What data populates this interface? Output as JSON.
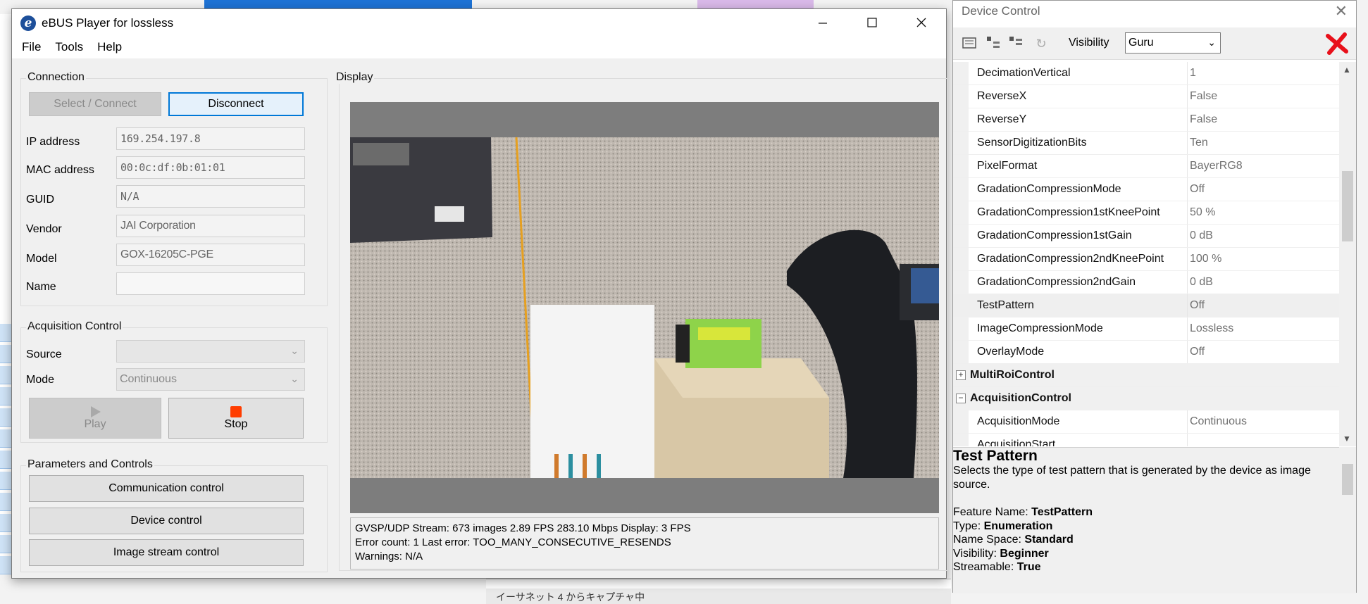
{
  "main_window": {
    "title": "eBUS Player for lossless",
    "menu": [
      "File",
      "Tools",
      "Help"
    ]
  },
  "connection": {
    "group_label": "Connection",
    "select_connect_label": "Select / Connect",
    "disconnect_label": "Disconnect",
    "fields": [
      {
        "label": "IP address",
        "value": "169.254.197.8"
      },
      {
        "label": "MAC address",
        "value": "00:0c:df:0b:01:01"
      },
      {
        "label": "GUID",
        "value": "N/A"
      },
      {
        "label": "Vendor",
        "value": "JAI Corporation"
      },
      {
        "label": "Model",
        "value": "GOX-16205C-PGE"
      },
      {
        "label": "Name",
        "value": ""
      }
    ]
  },
  "acquisition": {
    "group_label": "Acquisition Control",
    "source_label": "Source",
    "source_value": "",
    "mode_label": "Mode",
    "mode_value": "Continuous",
    "play_label": "Play",
    "stop_label": "Stop"
  },
  "params": {
    "group_label": "Parameters and Controls",
    "buttons": [
      "Communication control",
      "Device control",
      "Image stream control"
    ]
  },
  "display": {
    "group_label": "Display",
    "stats_line1": "GVSP/UDP Stream: 673 images    2.89 FPS    283.10 Mbps    Display: 3 FPS",
    "stats_line2": "Error count: 1    Last error: TOO_MANY_CONSECUTIVE_RESENDS",
    "stats_line3": "Warnings: N/A"
  },
  "device_control": {
    "title": "Device Control",
    "visibility_label": "Visibility",
    "visibility_value": "Guru",
    "rows": [
      {
        "name": "DecimationVertical",
        "value": "1",
        "type": "prop"
      },
      {
        "name": "ReverseX",
        "value": "False",
        "type": "prop"
      },
      {
        "name": "ReverseY",
        "value": "False",
        "type": "prop"
      },
      {
        "name": "SensorDigitizationBits",
        "value": "Ten",
        "type": "prop"
      },
      {
        "name": "PixelFormat",
        "value": "BayerRG8",
        "type": "prop"
      },
      {
        "name": "GradationCompressionMode",
        "value": "Off",
        "type": "prop"
      },
      {
        "name": "GradationCompression1stKneePoint",
        "value": "50 %",
        "type": "prop"
      },
      {
        "name": "GradationCompression1stGain",
        "value": "0 dB",
        "type": "prop"
      },
      {
        "name": "GradationCompression2ndKneePoint",
        "value": "100 %",
        "type": "prop"
      },
      {
        "name": "GradationCompression2ndGain",
        "value": "0 dB",
        "type": "prop"
      },
      {
        "name": "TestPattern",
        "value": "Off",
        "type": "selected"
      },
      {
        "name": "ImageCompressionMode",
        "value": "Lossless",
        "type": "prop"
      },
      {
        "name": "OverlayMode",
        "value": "Off",
        "type": "prop"
      },
      {
        "name": "MultiRoiControl",
        "value": "",
        "type": "cat-collapsed"
      },
      {
        "name": "AcquisitionControl",
        "value": "",
        "type": "cat-expanded"
      },
      {
        "name": "AcquisitionMode",
        "value": "Continuous",
        "type": "prop"
      },
      {
        "name": "AcquisitionStart",
        "value": "",
        "type": "prop"
      }
    ],
    "description": {
      "title": "Test Pattern",
      "text": "Selects the type of test pattern that is generated by the device as image source.",
      "feature_name_label": "Feature Name:",
      "feature_name": "TestPattern",
      "type_label": "Type:",
      "type": "Enumeration",
      "namespace_label": "Name Space:",
      "namespace": "Standard",
      "visibility_label": "Visibility:",
      "visibility": "Beginner",
      "streamable_label": "Streamable:",
      "streamable": "True"
    }
  },
  "background": {
    "bottom_text": "イーサネット 4 からキャプチャ中"
  }
}
